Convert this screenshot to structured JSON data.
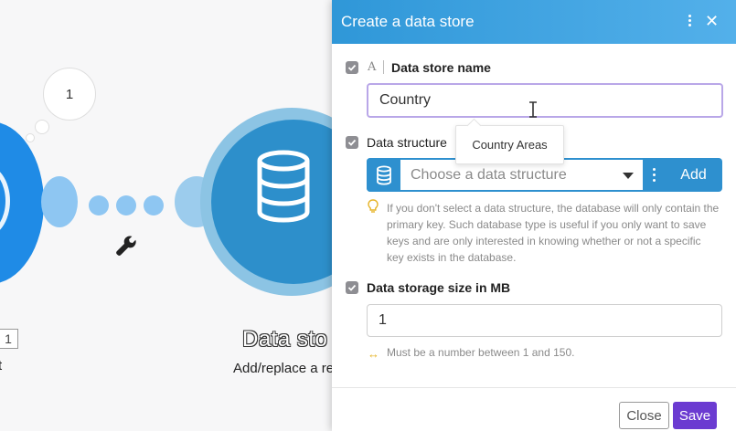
{
  "canvas": {
    "bubble_number": "1",
    "module_title": "Data sto",
    "module_subtitle": "Add/replace a re",
    "left_badge": "1",
    "left_label": "t"
  },
  "dialog": {
    "title": "Create a data store",
    "fields": {
      "name": {
        "label": "Data store name",
        "value": "Country",
        "type_icon": "A"
      },
      "structure": {
        "label": "Data structure",
        "tooltip": "Country Areas",
        "placeholder": "Choose a data structure",
        "add_label": "Add",
        "hint": "If you don't select a data structure, the database will only contain the primary key. Such database type is useful if you only want to save keys and are only interested in knowing whether or not a specific key exists in the database."
      },
      "size": {
        "label": "Data storage size in MB",
        "value": "1",
        "hint": "Must be a number between 1 and 150."
      }
    },
    "footer": {
      "close_label": "Close",
      "save_label": "Save"
    }
  },
  "colors": {
    "header_start": "#2f97d8",
    "header_end": "#53b0ea",
    "accent_blue": "#2e90cf",
    "save_purple": "#6b3bd1",
    "module_blue": "#1f8be6"
  }
}
